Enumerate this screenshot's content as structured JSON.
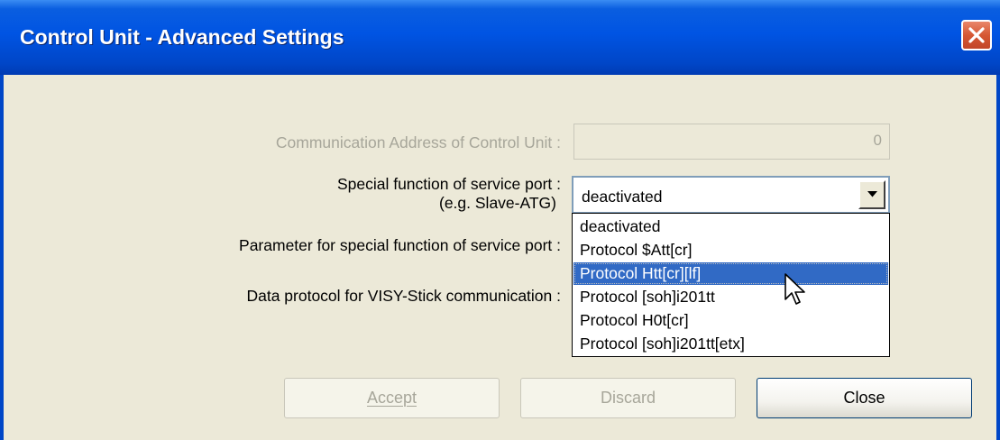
{
  "window": {
    "title": "Control Unit - Advanced Settings"
  },
  "form": {
    "comm_address_label": "Communication Address of Control Unit :",
    "comm_address_value": "0",
    "special_function_label_line1": "Special function of service port :",
    "special_function_label_line2": "(e.g. Slave-ATG)",
    "special_function_value": "deactivated",
    "param_label": "Parameter for special function of service port :",
    "data_protocol_label": "Data protocol for VISY-Stick communication :"
  },
  "dropdown": {
    "options": [
      "deactivated",
      "Protocol $Att[cr]",
      "Protocol Htt[cr][lf]",
      "Protocol [soh]i201tt",
      "Protocol H0t[cr]",
      "Protocol [soh]i201tt[etx]"
    ],
    "highlighted": "Protocol Htt[cr][lf]"
  },
  "buttons": {
    "accept": "Accept",
    "discard": "Discard",
    "close": "Close"
  },
  "colors": {
    "titlebar": "#0054E3",
    "dialog_bg": "#ECE9D8",
    "selection": "#316AC5",
    "close_button": "#D65834"
  }
}
